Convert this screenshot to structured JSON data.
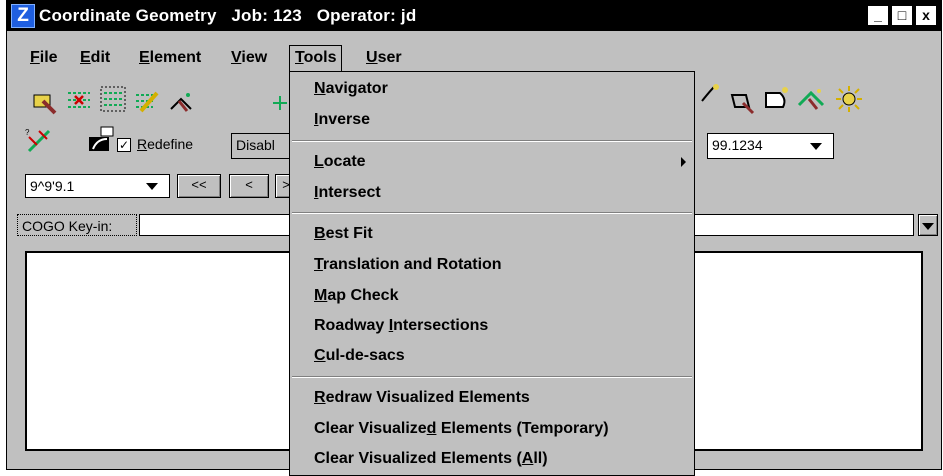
{
  "window": {
    "title": "Coordinate Geometry   Job: 123   Operator: jd",
    "controls": {
      "minimize": "_",
      "maximize": "□",
      "close": "x"
    }
  },
  "menubar": {
    "items": [
      {
        "label": "File"
      },
      {
        "label": "Edit"
      },
      {
        "label": "Element"
      },
      {
        "label": "View"
      },
      {
        "label": "Tools"
      },
      {
        "label": "User"
      }
    ]
  },
  "toolbar": {
    "redefine_label": "Redefine",
    "redefine_checked": "☑",
    "locate_mode_value": "Disabl",
    "precision_value": "99.1234",
    "angle_value": "9^9'9.1",
    "nav_first": "<<",
    "nav_prev": "<",
    "nav_next": ">"
  },
  "keyin": {
    "label": "COGO Key-in:",
    "value": ""
  },
  "tools_menu": {
    "groups": [
      [
        {
          "label": "Navigator"
        },
        {
          "label": "Inverse"
        }
      ],
      [
        {
          "label": "Locate",
          "submenu": true
        },
        {
          "label": "Intersect"
        }
      ],
      [
        {
          "label": "Best Fit"
        },
        {
          "label": "Translation and Rotation"
        },
        {
          "label": "Map Check"
        },
        {
          "label": "Roadway Intersections"
        },
        {
          "label": "Cul-de-sacs"
        }
      ],
      [
        {
          "label": "Redraw Visualized Elements"
        },
        {
          "label": "Clear Visualized Elements (Temporary)"
        },
        {
          "label": "Clear Visualized Elements (All)"
        }
      ]
    ]
  },
  "icons": [
    "locate-point-icon",
    "delete-element-icon",
    "select-elements-icon",
    "edit-element-icon",
    "visualize-point-icon",
    "store-point-icon",
    "locate-curve-icon",
    "locate-spiral-icon",
    "visualize-arrow-icon",
    "sun-icon",
    "redefine-line-icon",
    "display-curve-icon"
  ]
}
